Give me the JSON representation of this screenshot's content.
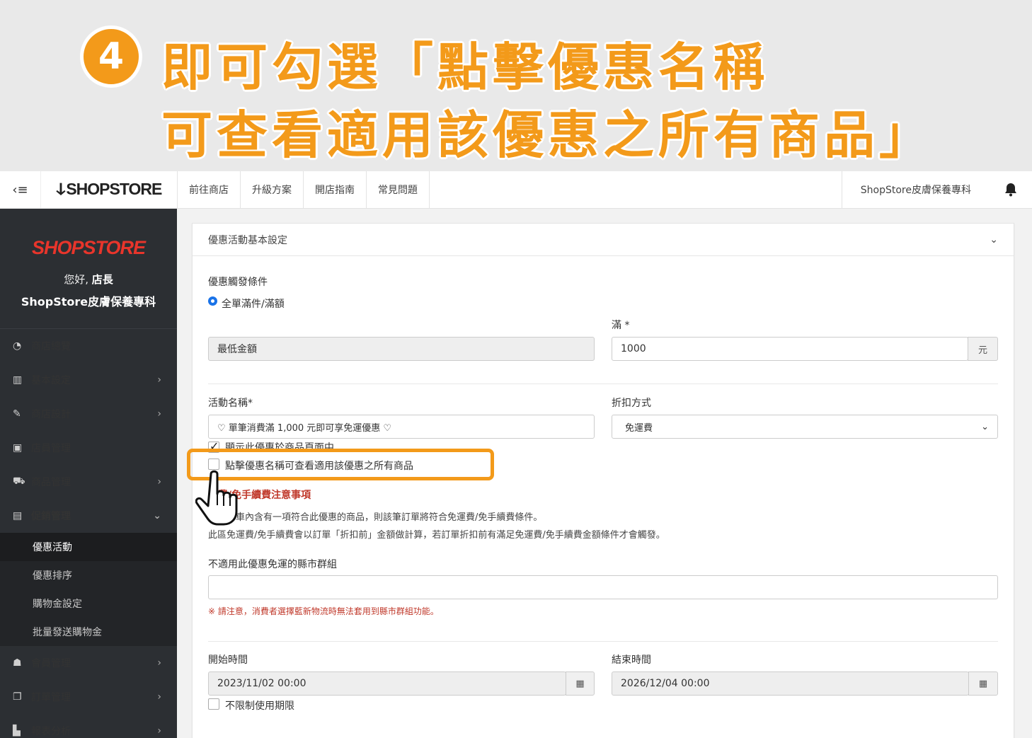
{
  "banner": {
    "step_number": "4",
    "line1": "即可勾選「點擊優惠名稱",
    "line2": "可查看適用該優惠之所有商品」",
    "accent_color": "#f39a1a"
  },
  "topbar": {
    "toggle_icon": "menu-collapse-icon",
    "brand": "SHOPSTORE",
    "nav": [
      "前往商店",
      "升級方案",
      "開店指南",
      "常見問題"
    ],
    "user": "ShopStore皮膚保養專科",
    "bell_icon": "bell-icon"
  },
  "sidebar": {
    "logo": "SHOPSTORE",
    "greeting_prefix": "您好,",
    "greeting_role": "店長",
    "store_name": "ShopStore皮膚保養專科",
    "items": [
      {
        "label": "商店總覽",
        "icon": "dashboard-icon",
        "chevron": ""
      },
      {
        "label": "基本設定",
        "icon": "bank-icon",
        "chevron": "›"
      },
      {
        "label": "商店設計",
        "icon": "magic-wand-icon",
        "chevron": "›"
      },
      {
        "label": "店員管理",
        "icon": "lock-icon",
        "chevron": ""
      },
      {
        "label": "商品管理",
        "icon": "cart-icon",
        "chevron": "›"
      },
      {
        "label": "促銷管理",
        "icon": "gift-icon",
        "chevron": "⌄"
      }
    ],
    "sub_items": [
      "優惠活動",
      "優惠排序",
      "購物金設定",
      "批量發送購物金"
    ],
    "items_after": [
      {
        "label": "會員管理",
        "icon": "users-icon",
        "chevron": "›"
      },
      {
        "label": "訂單管理",
        "icon": "copy-icon",
        "chevron": "›"
      },
      {
        "label": "報表分析",
        "icon": "bar-chart-icon",
        "chevron": "›"
      }
    ]
  },
  "card": {
    "title": "優惠活動基本設定",
    "chevron": "⌄",
    "trigger_label": "優惠觸發條件",
    "trigger_option": "全單滿件/滿額",
    "full_label": "滿 *",
    "min_amount_label": "最低金額",
    "amount_value": "1000",
    "amount_unit": "元",
    "name_label": "活動名稱*",
    "name_value": "♡ 單筆消費滿 1,000 元即可享免運優惠 ♡",
    "discount_label": "折扣方式",
    "discount_value": "免運費",
    "show_on_product_label": "顯示此優惠於商品頁面中",
    "click_name_label": "點擊優惠名稱可查看適用該優惠之所有商品",
    "notice_title": "運費/免手續費注意事項",
    "notice_line1": "若購物車內含有一項符合此優惠的商品，則該筆訂單將符合免運費/免手續費條件。",
    "notice_line2": "此區免運費/免手續費會以訂單「折扣前」金額做計算，若訂單折扣前有滿足免運費/免手續費金額條件才會觸發。",
    "exclude_label": "不適用此優惠免運的縣市群組",
    "exclude_note": "※ 請注意，消費者選擇藍新物流時無法套用到縣市群組功能。",
    "start_label": "開始時間",
    "start_value": "2023/11/02 00:00",
    "end_label": "結束時間",
    "end_value": "2026/12/04 00:00",
    "unlimited_label": "不限制使用期限"
  }
}
